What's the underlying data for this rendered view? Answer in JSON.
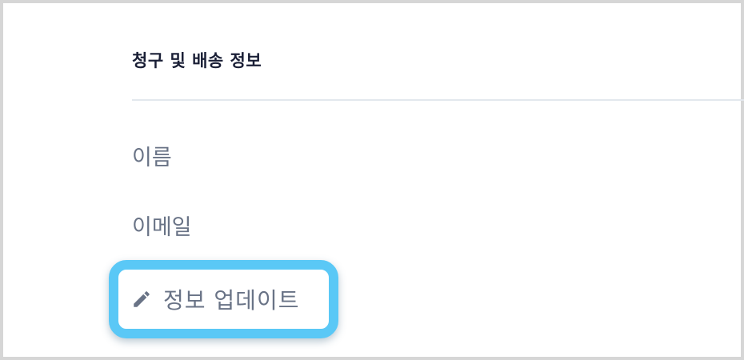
{
  "section": {
    "title": "청구 및 배송 정보"
  },
  "fields": {
    "name_label": "이름",
    "email_label": "이메일"
  },
  "actions": {
    "update_label": "정보 업데이트",
    "update_icon": "pencil-icon"
  },
  "colors": {
    "highlight": "#5ac8f6",
    "label_text": "#697386",
    "title_text": "#1a1f36"
  }
}
